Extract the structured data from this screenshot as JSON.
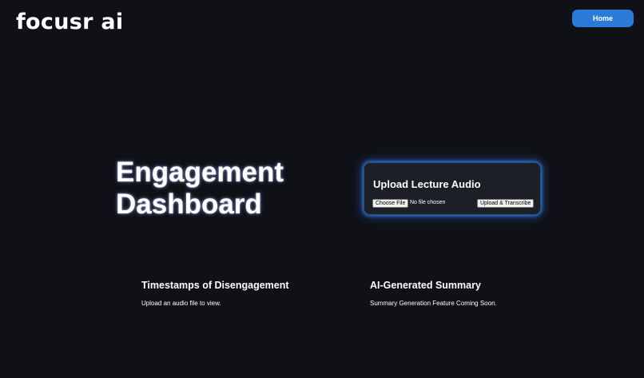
{
  "header": {
    "logo": "focusr ai",
    "home_label": "Home"
  },
  "hero": {
    "title_line1": "Engagement",
    "title_line2": "Dashboard"
  },
  "upload": {
    "title": "Upload Lecture Audio",
    "choose_file_label": "Choose File",
    "file_status": "No file chosen",
    "upload_button_label": "Upload & Transcribe"
  },
  "timestamps": {
    "title": "Timestamps of Disengagement",
    "message": "Upload an audio file to view."
  },
  "summary": {
    "title": "AI-Generated Summary",
    "message": "Summary Generation Feature Coming Soon."
  }
}
